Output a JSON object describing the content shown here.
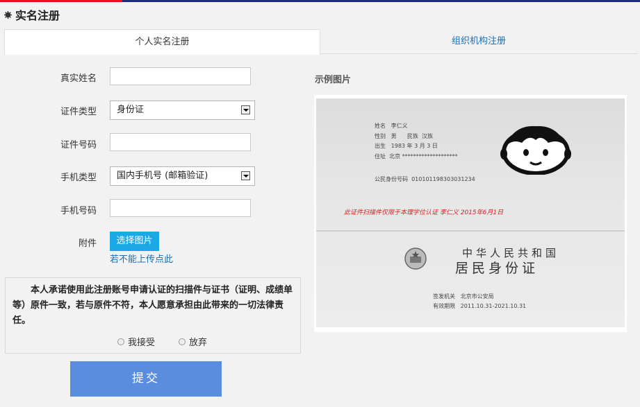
{
  "page_title": "实名注册",
  "tabs": [
    {
      "label": "个人实名注册"
    },
    {
      "label": "组织机构注册"
    }
  ],
  "form": {
    "real_name_label": "真实姓名",
    "real_name_value": "",
    "id_type_label": "证件类型",
    "id_type_value": "身份证",
    "id_number_label": "证件号码",
    "id_number_value": "",
    "phone_type_label": "手机类型",
    "phone_type_value": "国内手机号 (邮箱验证)",
    "phone_number_label": "手机号码",
    "phone_number_value": "",
    "attachment_label": "附件",
    "upload_button": "选择图片",
    "upload_help_link": "若不能上传点此"
  },
  "agreement": {
    "text": "本人承诺使用此注册账号申请认证的扫描件与证书（证明、成绩单等）原件一致，若与原件不符，本人愿意承担由此带来的一切法律责任。",
    "accept_label": "我接受",
    "decline_label": "放弃"
  },
  "submit_label": "提交",
  "sample": {
    "label": "示例图片",
    "card": {
      "name_label": "姓名",
      "name_value": "李仁义",
      "sex_label": "性别",
      "sex_value": "男",
      "ethnicity_label": "民族",
      "ethnicity_value": "汉族",
      "birth_label": "出生",
      "birth_value": "1983 年   3 月   3 日",
      "address_label": "住址",
      "address_value": "北京 ********************",
      "id_label": "公民身份号码",
      "id_value": "010101198303031234",
      "watermark": "此证件扫描件仅限于本理学位认证  李仁义  2015年6月1日",
      "country": "中华人民共和国",
      "card_title": "居民身份证",
      "issuer_label": "签发机关",
      "issuer_value": "北京市公安局",
      "validity_label": "有效期限",
      "validity_value": "2011.10.31-2021.10.31"
    }
  },
  "colors": {
    "topbar_blue": "#1b2a88",
    "topbar_red": "#e0141e",
    "tab_link": "#1a6fb5",
    "upload_button": "#1ba8e6",
    "submit_button": "#5b8ddf"
  }
}
